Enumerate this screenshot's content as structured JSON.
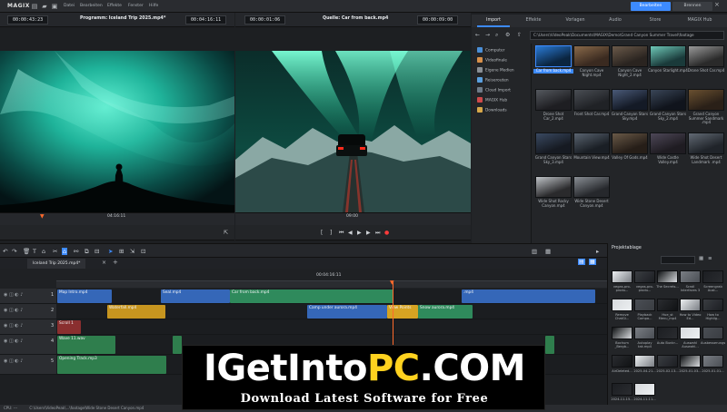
{
  "app": {
    "logo": "MAGIX",
    "menus": [
      "Datei",
      "Bearbeiten",
      "Effekte",
      "Fenster",
      "Hilfe"
    ],
    "modes": [
      {
        "label": "Bearbeiten",
        "active": true
      },
      {
        "label": "Brennen",
        "active": false
      }
    ],
    "accent": "#3d8bff"
  },
  "program_monitor": {
    "timecode_left": "00:00:43:23",
    "title": "Programm: Iceland Trip 2025.mp4*",
    "timecode_right": "00:04:16:11",
    "ruler_time": "04:16:11"
  },
  "source_monitor": {
    "timecode_left": "00:00:01:06",
    "title": "Quelle: Car from back.mp4",
    "timecode_right": "00:00:09:00",
    "ruler_time": "09:00"
  },
  "media_pool": {
    "tabs": [
      {
        "label": "Import",
        "active": true
      },
      {
        "label": "Effekte",
        "active": false
      },
      {
        "label": "Vorlagen",
        "active": false
      },
      {
        "label": "Audio",
        "active": false
      },
      {
        "label": "Store",
        "active": false
      },
      {
        "label": "MAGIX Hub",
        "active": false
      }
    ],
    "path": "C:\\Users\\VideoPeak\\Documents\\MAGIX\\Demo\\Grand Canyon Summer Travel\\footage",
    "sidebar": [
      {
        "label": "Computer",
        "color": "#4a8fd8"
      },
      {
        "label": "Videofinale",
        "color": "#d8904a"
      },
      {
        "label": "Eigene Medien",
        "color": "#8a8f95"
      },
      {
        "label": "Reiserouten",
        "color": "#5aa0e0"
      },
      {
        "label": "Cloud Import",
        "color": "#6f7b88"
      },
      {
        "label": "MAGIX Hub",
        "color": "#d04a4a"
      },
      {
        "label": "Downloads",
        "color": "#d8a84a"
      }
    ],
    "files": [
      {
        "label": "Car from back.mp4",
        "selected": true
      },
      {
        "label": "Canyon Cave Night.mp4"
      },
      {
        "label": "Canyon Cave Night_2.mp4"
      },
      {
        "label": "Canyon Starlight.mp4"
      },
      {
        "label": "Drone Shot Car.mp4"
      },
      {
        "label": "Drone Shot Car_2.mp4"
      },
      {
        "label": "Front Shot Car.mp4"
      },
      {
        "label": "Grand Canyon Stars Sky.mp4"
      },
      {
        "label": "Grand Canyon Stars Sky_2.mp4"
      },
      {
        "label": "Grand Canyon Summer Sandmark .mp4"
      },
      {
        "label": "Grand Canyon Stars Sky_3.mp4"
      },
      {
        "label": "Mountain View.mp4"
      },
      {
        "label": "Valley Of Gods.mp4"
      },
      {
        "label": "Wide Castle Valley.mp4"
      },
      {
        "label": "Wide Shot Desert Landmark .mp4"
      },
      {
        "label": "Wide Shot Rocky Canyon.mp4"
      },
      {
        "label": "Wide Stone Desert Canyon.mp4"
      }
    ]
  },
  "timeline": {
    "tab_label": "Iceland Trip 2025.mp4*",
    "ruler_time": "00:04:16:11",
    "track_numbers": [
      "1",
      "2",
      "3",
      "4",
      "5"
    ],
    "clips": [
      {
        "label": "Map Intro.mp4"
      },
      {
        "label": "Seal.mp4"
      },
      {
        "label": "Car from back.mp4"
      },
      {
        "label": ".mp4"
      },
      {
        "label": "Waterfall.mp4"
      },
      {
        "label": "Camp under aurora.mp4"
      },
      {
        "label": "View Points"
      },
      {
        "label": "Snow aurora.mp4"
      },
      {
        "label": "Scroll 1"
      },
      {
        "label": "Wave 11.wav"
      },
      {
        "label": "Opening Track.mp3"
      }
    ]
  },
  "project_bin": {
    "title": "Projektablage",
    "items": [
      "vegas-pro-produ...",
      "vegas-pro-produ...",
      "The Secrets...",
      "Scroll Interfaces 3",
      "Screengrab Aust...",
      "Remove ChatGi...",
      "Playback Compa...",
      "Hue_st Menu_mp4",
      "How to Video Ed...",
      "How to Highlig...",
      "Bochum _Bergb...",
      "Autoplay tak.mp4",
      "Auto Bunkr...",
      "Auswahl Auswahl...",
      "Ausbesserungsw...",
      "AirDeleted...",
      "2025-04-21...",
      "2025-02-13...",
      "2025-01-03...",
      "2025-01-01...",
      "2024-11-15...",
      "2024-11-11..."
    ]
  },
  "status": {
    "cpu": "CPU: ---",
    "path": "C:\\Users\\VideoPeak\\...\\footage\\Wide Stone Desert Canyon.mp4"
  },
  "watermark": {
    "title_part1": "IGetInto",
    "title_part2": "PC",
    "title_part3": ".COM",
    "subtitle": "Download Latest Software for Free"
  }
}
